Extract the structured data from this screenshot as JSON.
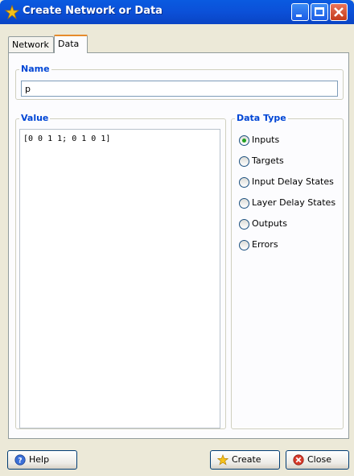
{
  "window": {
    "title": "Create Network or Data",
    "title_icon": "star-icon"
  },
  "tabs": [
    {
      "label": "Network"
    },
    {
      "label": "Data"
    }
  ],
  "name_group": {
    "legend": "Name",
    "value": "p"
  },
  "value_group": {
    "legend": "Value",
    "text": "[0 0 1 1; 0 1 0 1]"
  },
  "data_type": {
    "legend": "Data Type",
    "options": [
      {
        "label": "Inputs",
        "selected": true
      },
      {
        "label": "Targets",
        "selected": false
      },
      {
        "label": "Input Delay States",
        "selected": false
      },
      {
        "label": "Layer Delay States",
        "selected": false
      },
      {
        "label": "Outputs",
        "selected": false
      },
      {
        "label": "Errors",
        "selected": false
      }
    ]
  },
  "buttons": {
    "help": "Help",
    "create": "Create",
    "close": "Close"
  },
  "colors": {
    "titlebar": "#0a5ae0",
    "legend": "#0046d5",
    "selected_radio": "#21a121"
  }
}
